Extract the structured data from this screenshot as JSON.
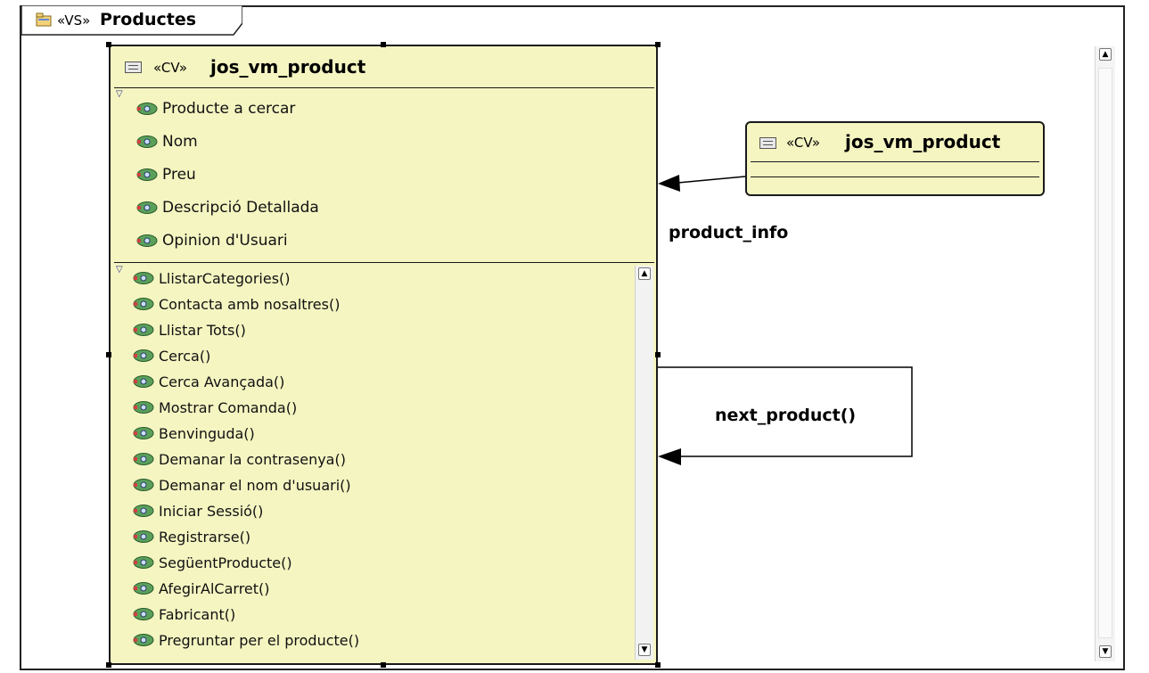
{
  "package": {
    "stereotype": "«VS»",
    "title": "Productes"
  },
  "main_class": {
    "stereotype": "«CV»",
    "name": "jos_vm_product",
    "attributes": [
      "Producte a cercar",
      "Nom",
      "Preu",
      "Descripció Detallada",
      "Opinion d'Usuari"
    ],
    "operations": [
      "LlistarCategories()",
      "Contacta amb nosaltres()",
      "Llistar Tots()",
      "Cerca()",
      "Cerca Avançada()",
      "Mostrar Comanda()",
      "Benvinguda()",
      "Demanar la contrasenya()",
      "Demanar el nom d'usuari()",
      "Iniciar Sessió()",
      "Registrarse()",
      "SegüentProducte()",
      "AfegirAlCarret()",
      "Fabricant()",
      "Pregruntar per el producte()"
    ]
  },
  "secondary_class": {
    "stereotype": "«CV»",
    "name": "jos_vm_product"
  },
  "relations": {
    "association_label": "product_info",
    "self_label": "next_product()"
  },
  "icons": {
    "package": "package-icon",
    "class": "class-icon",
    "member": "member-icon",
    "collapse": "collapse-triangle-icon"
  },
  "colors": {
    "class_fill": "#f5f5c2",
    "member_icon": "#3a7a3a",
    "stroke": "#1a1a1a"
  }
}
